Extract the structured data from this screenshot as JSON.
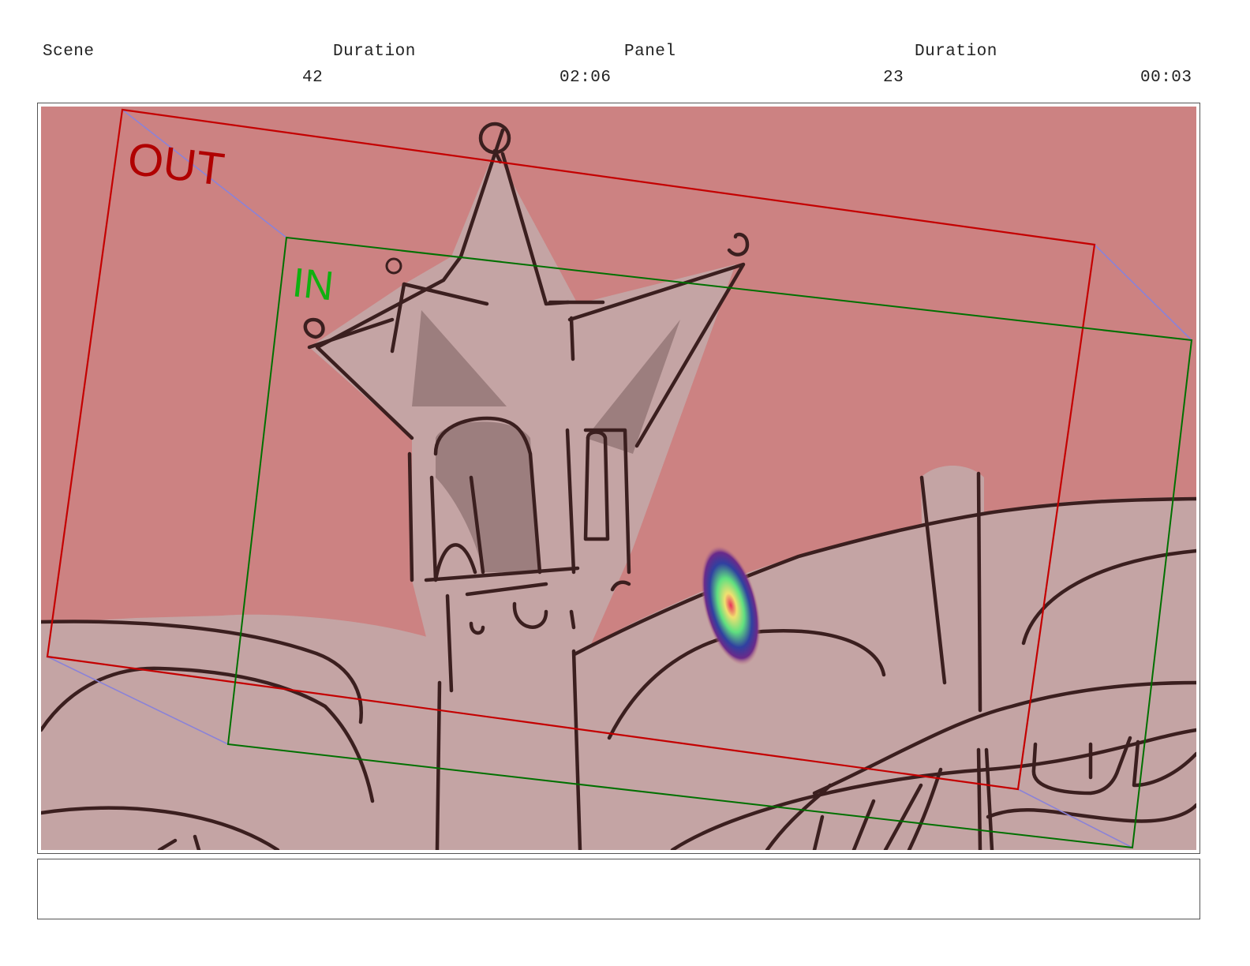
{
  "header": {
    "scene_label": "Scene",
    "scene_duration_label": "Duration",
    "panel_label": "Panel",
    "panel_duration_label": "Duration",
    "scene_number": "42",
    "scene_duration": "02:06",
    "panel_number": "23",
    "panel_duration": "00:03"
  },
  "panel": {
    "camera_out_label": "OUT",
    "camera_in_label": "IN",
    "colors": {
      "background": "#cc8282",
      "building_fill": "#c4a4a4",
      "shadow_fill": "#9c7e7e",
      "line": "#3b1f1f",
      "camera_out": "#c40000",
      "camera_in": "#007000",
      "camera_path": "#8a82d8"
    }
  },
  "notes": {
    "text": ""
  }
}
